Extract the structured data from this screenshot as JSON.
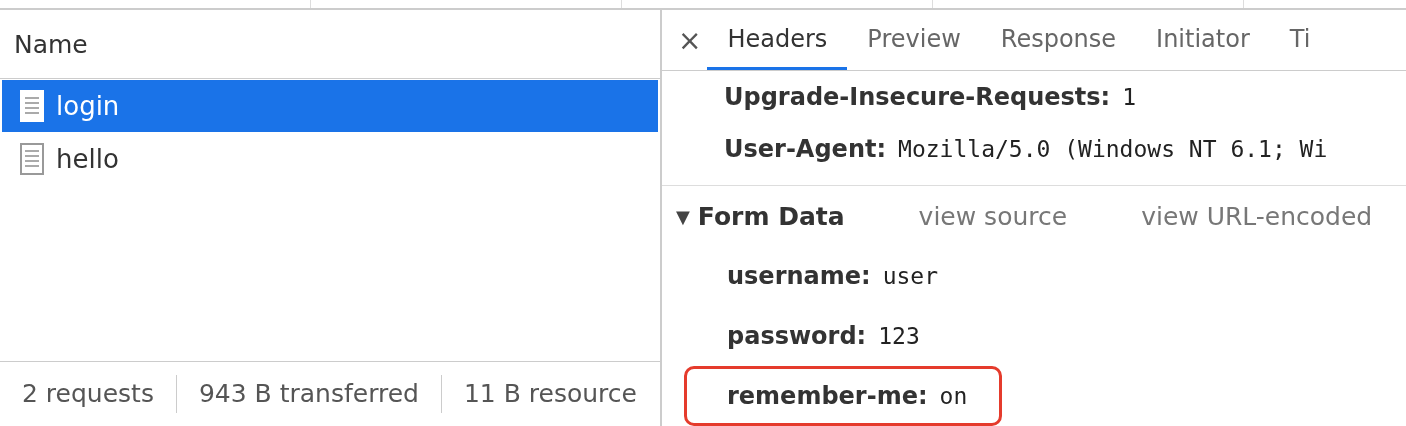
{
  "requests": {
    "column": "Name",
    "rows": [
      {
        "name": "login",
        "selected": true
      },
      {
        "name": "hello",
        "selected": false
      }
    ]
  },
  "status_bar": [
    "2 requests",
    "943 B transferred",
    "11 B resource"
  ],
  "details": {
    "close": "×",
    "tabs": [
      {
        "label": "Headers",
        "selected": true
      },
      {
        "label": "Preview",
        "selected": false
      },
      {
        "label": "Response",
        "selected": false
      },
      {
        "label": "Initiator",
        "selected": false
      },
      {
        "label": "Ti",
        "selected": false
      }
    ],
    "request_headers": [
      {
        "name": "Upgrade-Insecure-Requests:",
        "value": "1"
      },
      {
        "name": "User-Agent:",
        "value": "Mozilla/5.0 (Windows NT 6.1; Wi"
      }
    ],
    "form_data": {
      "toggle": "▼",
      "title": "Form Data",
      "expanded": true,
      "links": [
        "view source",
        "view URL-encoded"
      ],
      "fields": [
        {
          "name": "username:",
          "value": "user",
          "highlighted": false
        },
        {
          "name": "password:",
          "value": "123",
          "highlighted": false
        },
        {
          "name": "remember-me:",
          "value": "on",
          "highlighted": true
        }
      ]
    }
  }
}
